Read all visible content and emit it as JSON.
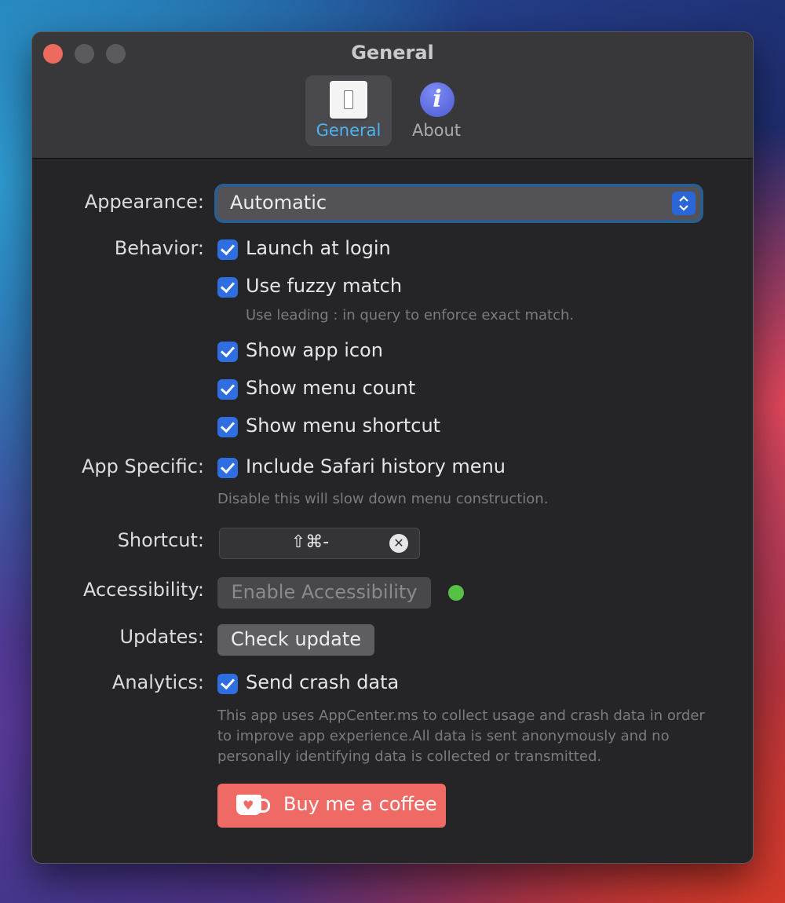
{
  "window": {
    "title": "General"
  },
  "tabs": [
    {
      "label": "General",
      "icon": "switch-icon",
      "selected": true
    },
    {
      "label": "About",
      "icon": "info-icon",
      "selected": false
    }
  ],
  "appearance": {
    "label": "Appearance:",
    "value": "Automatic"
  },
  "behavior": {
    "label": "Behavior:",
    "options": [
      {
        "label": "Launch at login",
        "checked": true
      },
      {
        "label": "Use fuzzy match",
        "checked": true
      },
      {
        "label": "Show app icon",
        "checked": true
      },
      {
        "label": "Show menu count",
        "checked": true
      },
      {
        "label": "Show menu shortcut",
        "checked": true
      }
    ],
    "fuzzy_hint": "Use leading : in query to enforce exact match."
  },
  "app_specific": {
    "label": "App Specific:",
    "option": {
      "label": "Include Safari history menu",
      "checked": true
    },
    "hint": "Disable this will slow down menu construction."
  },
  "shortcut": {
    "label": "Shortcut:",
    "keys": "⇧⌘-"
  },
  "accessibility": {
    "label": "Accessibility:",
    "button": "Enable Accessibility",
    "status_color": "#56c144"
  },
  "updates": {
    "label": "Updates:",
    "button": "Check update"
  },
  "analytics": {
    "label": "Analytics:",
    "option": {
      "label": "Send crash data",
      "checked": true
    },
    "hint": "This app uses AppCenter.ms to collect usage and crash data in order to improve app experience.All data is sent anonymously and no personally identifying data is collected or transmitted."
  },
  "donate": {
    "button": "Buy me a coffee"
  },
  "colors": {
    "accent": "#2e6ee0",
    "tab_selected_text": "#4bb4f0",
    "coffee": "#ef6a64"
  }
}
